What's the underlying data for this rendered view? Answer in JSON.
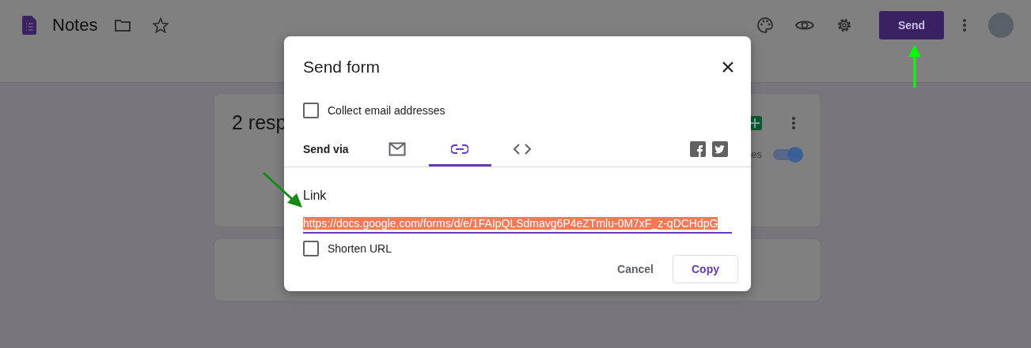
{
  "header": {
    "title": "Notes",
    "send_button": "Send"
  },
  "card": {
    "title": "2 resp",
    "toggle_label": "es",
    "toggle_on": true
  },
  "dialog": {
    "title": "Send form",
    "collect_email": {
      "label": "Collect email addresses",
      "checked": false
    },
    "send_via_label": "Send via",
    "tabs": [
      {
        "kind": "email",
        "selected": false
      },
      {
        "kind": "link",
        "selected": true
      },
      {
        "kind": "embed",
        "selected": false
      }
    ],
    "link_heading": "Link",
    "link_url": "https://docs.google.com/forms/d/e/1FAIpQLSdmavg6P4eZTmlu-0M7xF_z-qDCHdpG",
    "shorten_url": {
      "label": "Shorten URL",
      "checked": false
    },
    "buttons": [
      {
        "label": "Cancel",
        "kind": "text"
      },
      {
        "label": "Copy",
        "kind": "outlined"
      }
    ]
  }
}
